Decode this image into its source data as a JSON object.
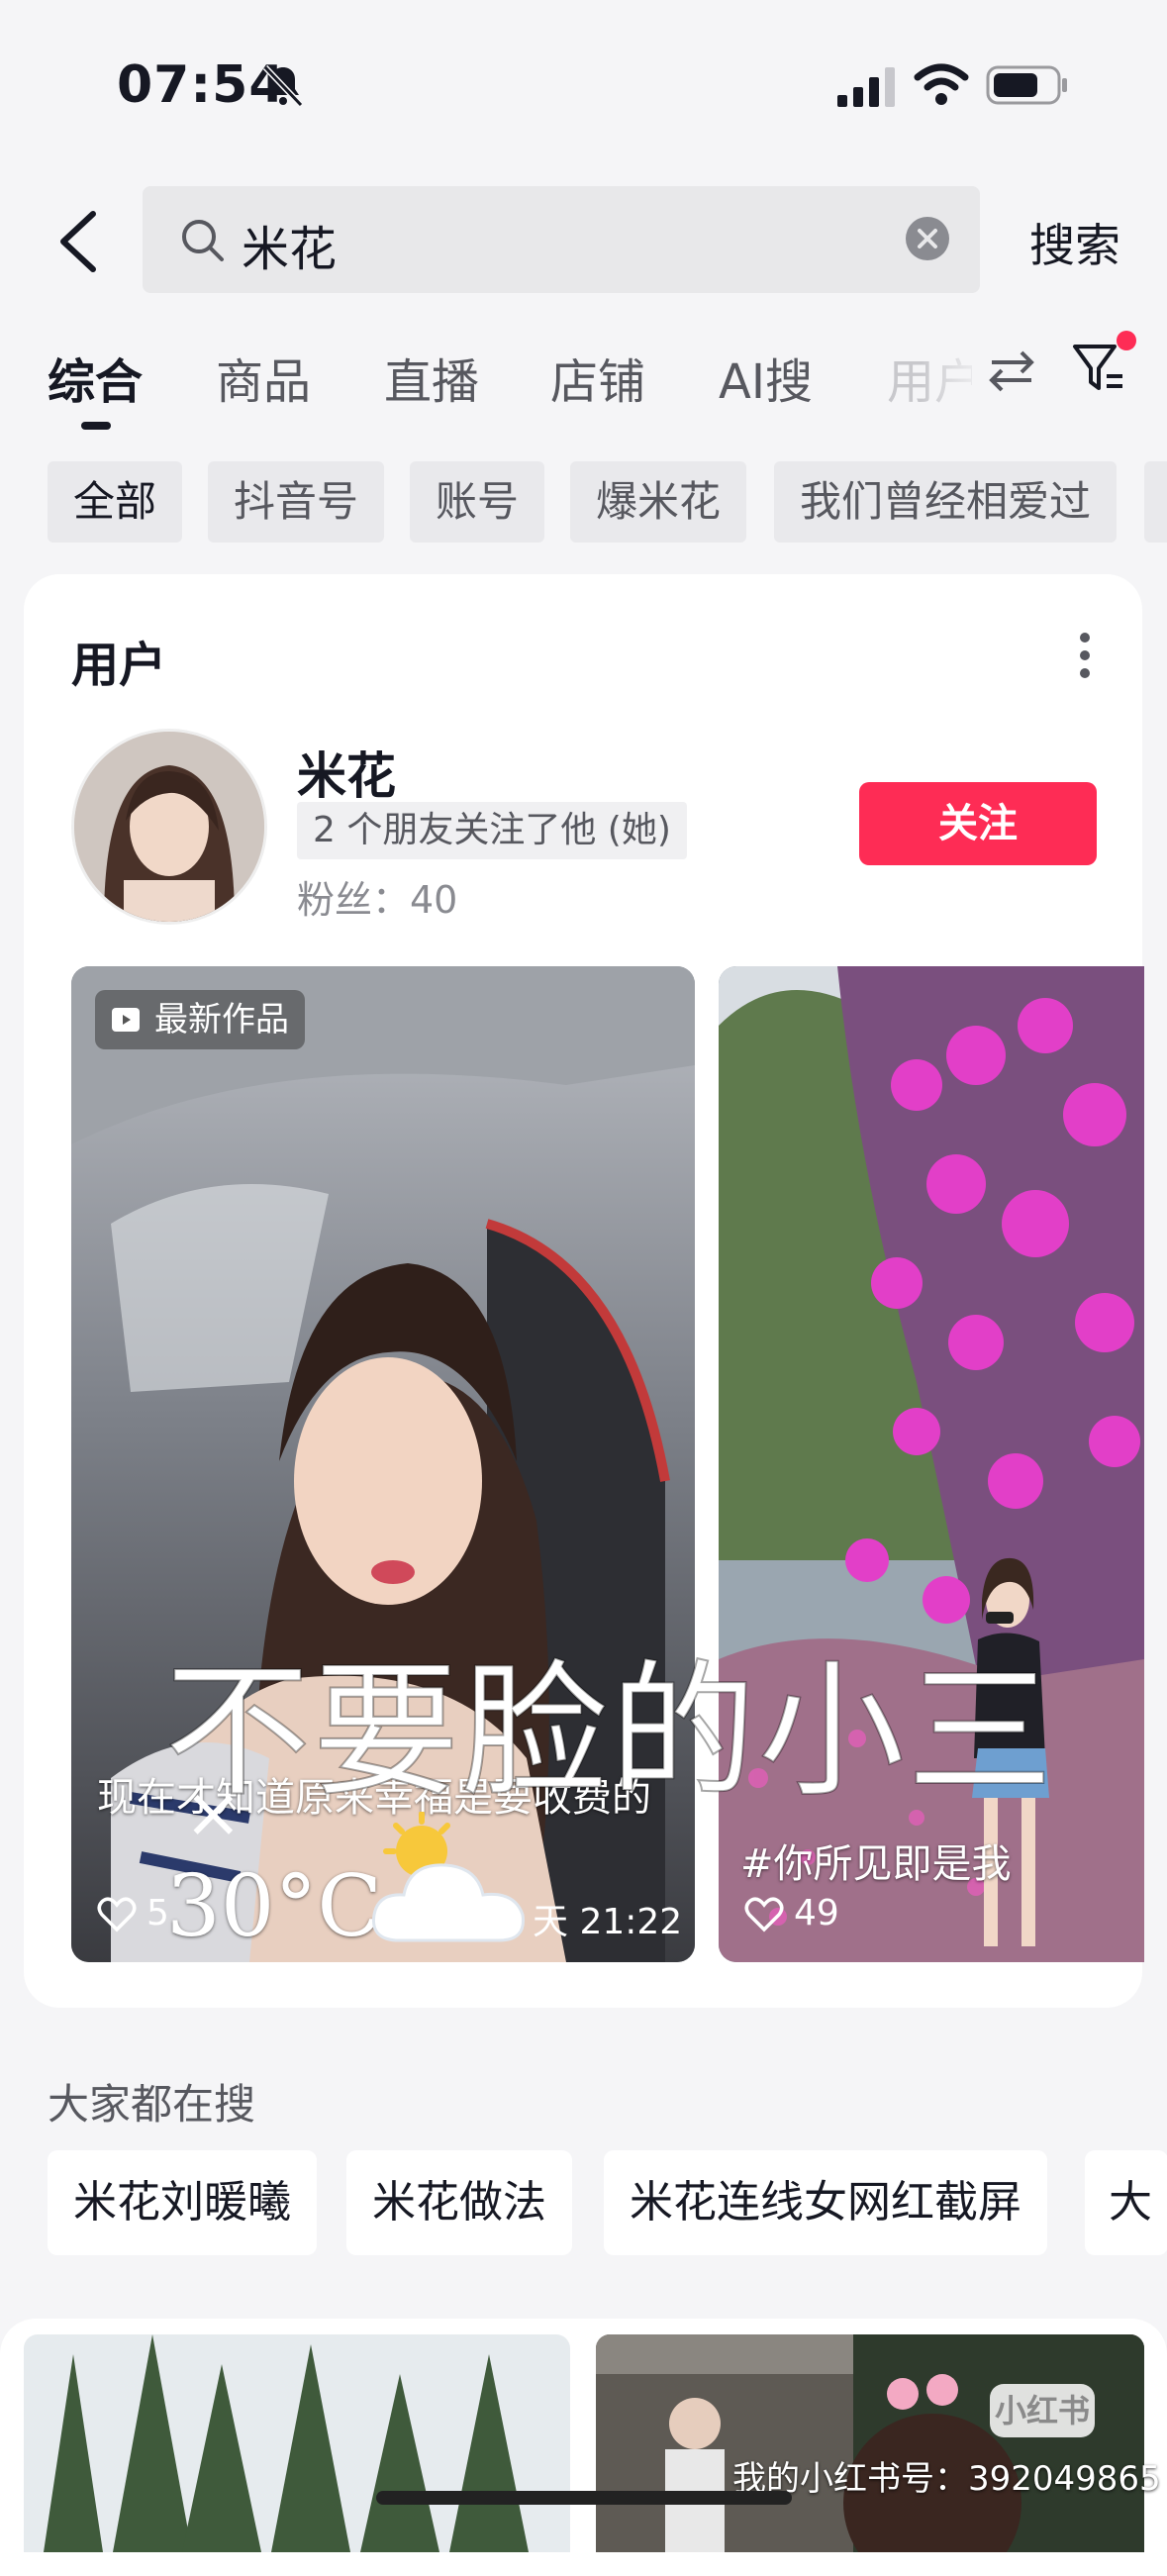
{
  "status_bar": {
    "time": "07:54"
  },
  "search": {
    "query": "米花",
    "button_label": "搜索"
  },
  "tabs": [
    {
      "label": "综合",
      "active": true
    },
    {
      "label": "商品"
    },
    {
      "label": "直播"
    },
    {
      "label": "店铺"
    },
    {
      "label": "AI搜"
    },
    {
      "label": "用户"
    }
  ],
  "chips": [
    "全部",
    "抖音号",
    "账号",
    "爆米花",
    "我们曾经相爱过"
  ],
  "user_section": {
    "title": "用户",
    "user": {
      "name": "米花",
      "friends_badge": "2 个朋友关注了他 (她)",
      "followers": "粉丝：40",
      "follow_label": "关注"
    },
    "posts": [
      {
        "badge": "最新作品",
        "caption": "现在才知道原来幸福是要收费的",
        "likes": "5",
        "date": "天 21:22"
      },
      {
        "caption": "#你所见即是我",
        "likes": "49"
      }
    ]
  },
  "overlay": {
    "big_text": "不要脸的小三",
    "x_mark": "×",
    "temperature": "30°C"
  },
  "trending": {
    "title": "大家都在搜",
    "items": [
      "米花刘暖曦",
      "米花做法",
      "米花连线女网红截屏",
      "大"
    ]
  },
  "watermark": {
    "logo": "小红书",
    "text": "我的小红书号：392049865"
  },
  "colors": {
    "accent": "#fe2c55",
    "background": "#f5f5f7"
  }
}
